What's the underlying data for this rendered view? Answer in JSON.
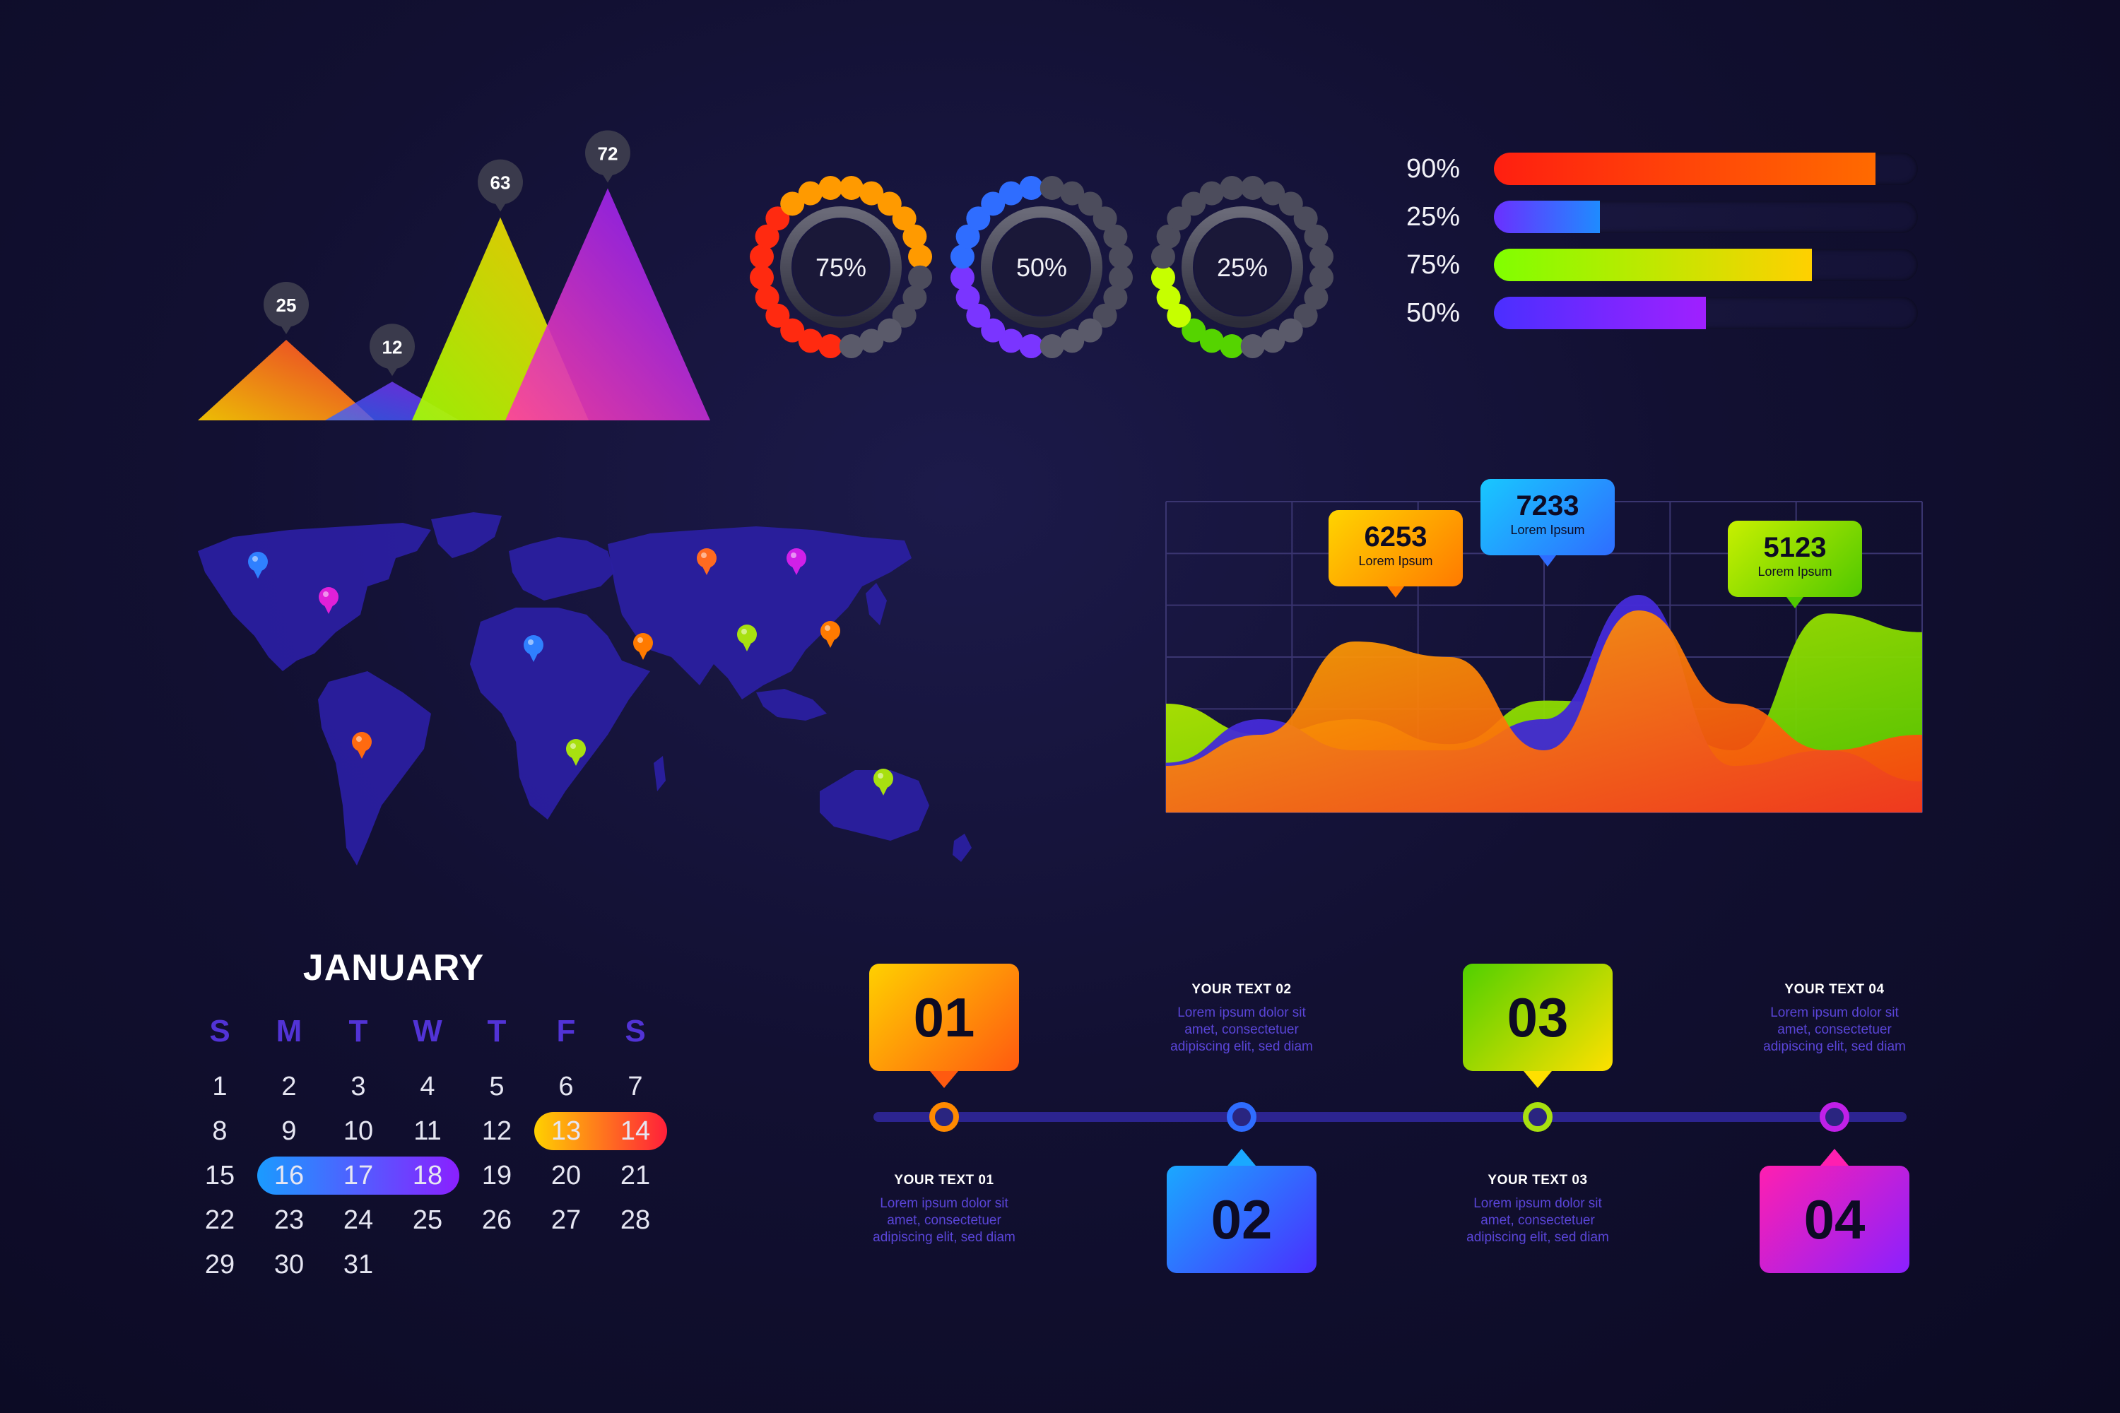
{
  "triangle_chart": {
    "type": "bar",
    "values": [
      25,
      12,
      63,
      72
    ],
    "ylim": [
      0,
      80
    ],
    "colors": [
      [
        "#ffcc00",
        "#ff3a2b"
      ],
      [
        "#2f66ff",
        "#8a2bff"
      ],
      [
        "#a6ff00",
        "#ffd000"
      ],
      [
        "#ff3fa0",
        "#7b1bff"
      ]
    ]
  },
  "donuts": [
    {
      "label": "75%",
      "value": 75,
      "colors": [
        "#ff9a00",
        "#ff2a10"
      ]
    },
    {
      "label": "50%",
      "value": 50,
      "colors": [
        "#2f6dff",
        "#7a35ff"
      ]
    },
    {
      "label": "25%",
      "value": 25,
      "colors": [
        "#c6ff00",
        "#55d400"
      ]
    }
  ],
  "progress_bars": [
    {
      "label": "90%",
      "value": 90,
      "colors": [
        "#ff6a00",
        "#ff1f10"
      ]
    },
    {
      "label": "25%",
      "value": 25,
      "colors": [
        "#1f8bff",
        "#6a30ff"
      ]
    },
    {
      "label": "75%",
      "value": 75,
      "colors": [
        "#ffd000",
        "#80ff00"
      ]
    },
    {
      "label": "50%",
      "value": 50,
      "colors": [
        "#a020ff",
        "#4a2fff"
      ]
    }
  ],
  "map": {
    "land_color": "#2a1fa0",
    "pins": [
      {
        "name": "canada",
        "color": "#2f80ff"
      },
      {
        "name": "usa",
        "color": "#e020d8"
      },
      {
        "name": "south-america",
        "color": "#ff6a10"
      },
      {
        "name": "west-africa",
        "color": "#2f80ff"
      },
      {
        "name": "middle-east",
        "color": "#ff7a00"
      },
      {
        "name": "south-africa",
        "color": "#a8e010"
      },
      {
        "name": "scandinavia",
        "color": "#ff6a20"
      },
      {
        "name": "russia",
        "color": "#d020e8"
      },
      {
        "name": "india",
        "color": "#a8e010"
      },
      {
        "name": "china",
        "color": "#ff7a00"
      },
      {
        "name": "australia",
        "color": "#a8e010"
      }
    ]
  },
  "area_chart": {
    "type": "area",
    "series": [
      {
        "values": [
          0.35,
          0.25,
          0.3,
          0.22,
          0.36,
          0.35,
          0.2,
          0.64,
          0.58
        ],
        "colors": [
          "#c8f000",
          "#50c800"
        ]
      },
      {
        "values": [
          0.16,
          0.3,
          0.2,
          0.2,
          0.3,
          0.7,
          0.15,
          0.2,
          0.1
        ],
        "colors": [
          "#4a2fe0",
          "#3a22c8"
        ]
      },
      {
        "values": [
          0.15,
          0.25,
          0.55,
          0.5,
          0.2,
          0.65,
          0.35,
          0.2,
          0.25
        ],
        "colors": [
          "#ffb000",
          "#ff3a10"
        ]
      }
    ],
    "callouts": [
      {
        "value": "6253",
        "label": "Lorem Ipsum",
        "colors": [
          "#ffd400",
          "#ff7a00"
        ]
      },
      {
        "value": "7233",
        "label": "Lorem Ipsum",
        "colors": [
          "#18c8ff",
          "#2f6dff"
        ]
      },
      {
        "value": "5123",
        "label": "Lorem Ipsum",
        "colors": [
          "#c8f000",
          "#50c800"
        ]
      }
    ]
  },
  "calendar": {
    "month": "JANUARY",
    "weekdays": [
      "S",
      "M",
      "T",
      "W",
      "T",
      "F",
      "S"
    ],
    "days": [
      [
        "1",
        "2",
        "3",
        "4",
        "5",
        "6",
        "7"
      ],
      [
        "8",
        "9",
        "10",
        "11",
        "12",
        "13",
        "14"
      ],
      [
        "15",
        "16",
        "17",
        "18",
        "19",
        "20",
        "21"
      ],
      [
        "22",
        "23",
        "24",
        "25",
        "26",
        "27",
        "28"
      ],
      [
        "29",
        "30",
        "31",
        "",
        "",
        "",
        ""
      ]
    ],
    "highlights": [
      {
        "row": 1,
        "from": 5,
        "to": 6,
        "colors": [
          "#ffd000",
          "#ff1f3a"
        ]
      },
      {
        "row": 2,
        "from": 1,
        "to": 3,
        "colors": [
          "#1a9bff",
          "#8a20ff"
        ]
      }
    ]
  },
  "timeline": {
    "line_color": "#2c2490",
    "steps": [
      {
        "number": "01",
        "title": "YOUR TEXT 01",
        "text": [
          "Lorem ipsum dolor sit",
          "amet, consectetuer",
          "adipiscing elit, sed diam"
        ],
        "colors": [
          "#ffd000",
          "#ff5a10"
        ],
        "ring": "#ff8a00"
      },
      {
        "number": "02",
        "title": "YOUR TEXT 02",
        "text": [
          "Lorem ipsum dolor sit",
          "amet, consectetuer",
          "adipiscing elit, sed diam"
        ],
        "colors": [
          "#1aa8ff",
          "#4a2fff"
        ],
        "ring": "#2f6dff"
      },
      {
        "number": "03",
        "title": "YOUR TEXT 03",
        "text": [
          "Lorem ipsum dolor sit",
          "amet, consectetuer",
          "adipiscing elit, sed diam"
        ],
        "colors": [
          "#50d000",
          "#ffe000"
        ],
        "ring": "#a8e010"
      },
      {
        "number": "04",
        "title": "YOUR TEXT 04",
        "text": [
          "Lorem ipsum dolor sit",
          "amet, consectetuer",
          "adipiscing elit, sed diam"
        ],
        "colors": [
          "#ff1fb0",
          "#8a20ff"
        ],
        "ring": "#c020e8"
      }
    ]
  }
}
